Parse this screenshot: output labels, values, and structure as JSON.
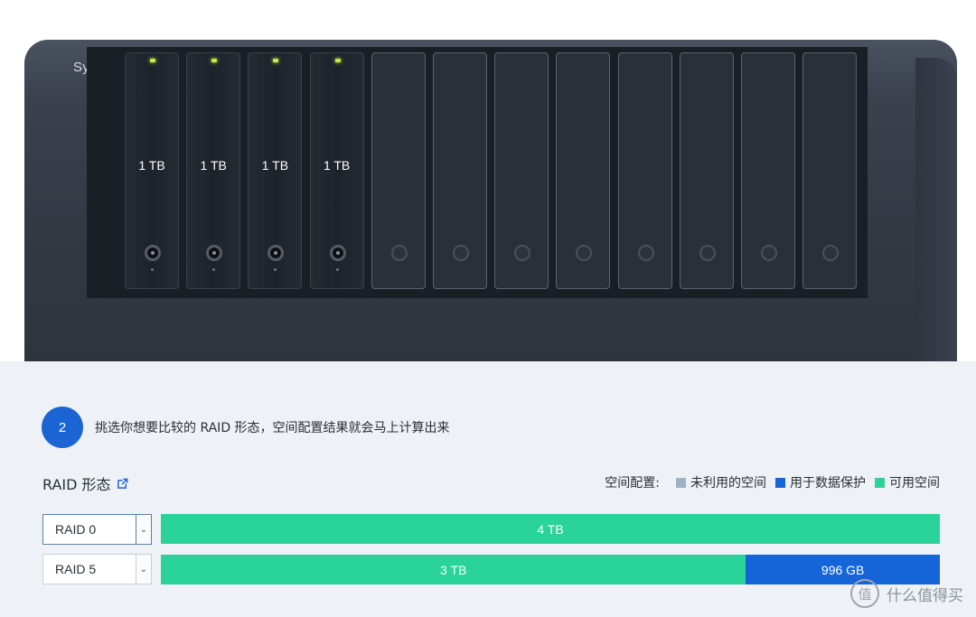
{
  "device": {
    "brand": "Synology",
    "power_symbol": "⏻",
    "bays": [
      {
        "label": "1 TB",
        "filled": true
      },
      {
        "label": "1 TB",
        "filled": true
      },
      {
        "label": "1 TB",
        "filled": true
      },
      {
        "label": "1 TB",
        "filled": true
      },
      {
        "label": "",
        "filled": false
      },
      {
        "label": "",
        "filled": false
      },
      {
        "label": "",
        "filled": false
      },
      {
        "label": "",
        "filled": false
      },
      {
        "label": "",
        "filled": false
      },
      {
        "label": "",
        "filled": false
      },
      {
        "label": "",
        "filled": false
      },
      {
        "label": "",
        "filled": false
      }
    ]
  },
  "step": {
    "number": "2",
    "text": "挑选你想要比较的 RAID 形态，空间配置结果就会马上计算出来"
  },
  "raid_section": {
    "label": "RAID 形态"
  },
  "legend": {
    "title": "空间配置:",
    "items": [
      {
        "label": "未利用的空间",
        "color": "#9fb1c4"
      },
      {
        "label": "用于数据保护",
        "color": "#1565d8"
      },
      {
        "label": "可用空间",
        "color": "#2ad39a"
      }
    ]
  },
  "rows": [
    {
      "raid": "RAID 0",
      "segments": [
        {
          "label": "4 TB",
          "type": "available",
          "fraction": 1.0
        }
      ]
    },
    {
      "raid": "RAID 5",
      "segments": [
        {
          "label": "3 TB",
          "type": "available",
          "fraction": 0.751
        },
        {
          "label": "996 GB",
          "type": "protection",
          "fraction": 0.249
        }
      ]
    }
  ],
  "colors": {
    "available": "#2ad39a",
    "protection": "#1565d8",
    "unused": "#9fb1c4",
    "accent": "#1a64d4"
  },
  "watermark": {
    "logo": "值",
    "text": "什么值得买"
  }
}
